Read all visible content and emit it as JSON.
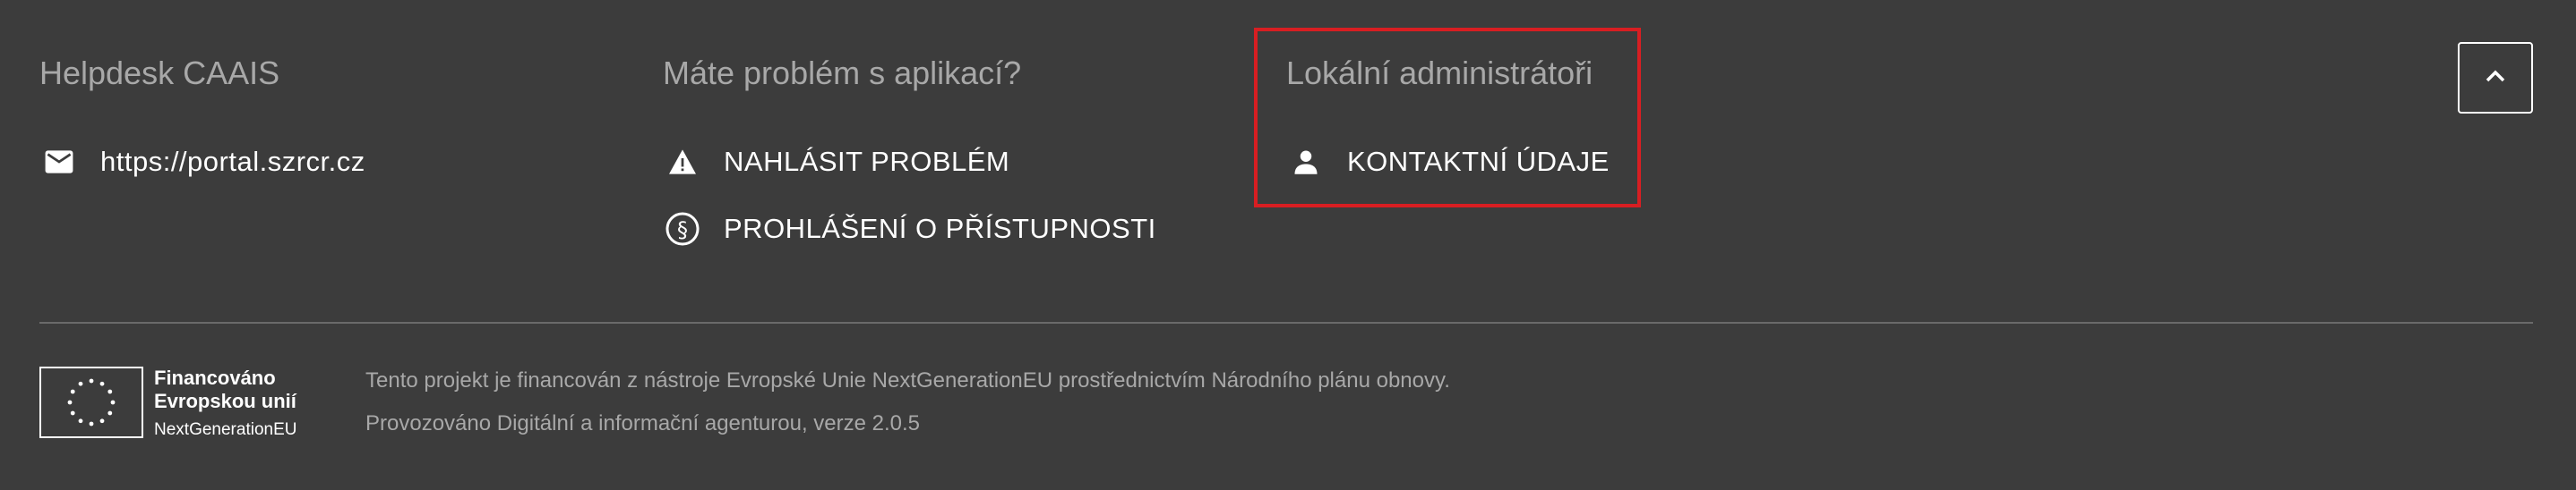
{
  "columns": [
    {
      "title": "Helpdesk CAAIS",
      "links": [
        {
          "icon": "mail-icon",
          "label": "https://portal.szrcr.cz"
        }
      ]
    },
    {
      "title": "Máte problém s aplikací?",
      "links": [
        {
          "icon": "warning-icon",
          "label": "NAHLÁSIT PROBLÉM"
        },
        {
          "icon": "paragraph-icon",
          "label": "PROHLÁŠENÍ O PŘÍSTUPNOSTI"
        }
      ]
    },
    {
      "title": "Lokální administrátoři",
      "links": [
        {
          "icon": "person-icon",
          "label": "KONTAKTNÍ ÚDAJE"
        }
      ]
    }
  ],
  "scroll_top": {
    "icon": "chevron-up-icon"
  },
  "eu_logo": {
    "line1": "Financováno",
    "line2": "Evropskou unií",
    "line3": "NextGenerationEU"
  },
  "info": {
    "funding": "Tento projekt je financován z nástroje Evropské Unie NextGenerationEU prostřednictvím Národního plánu obnovy.",
    "operator": "Provozováno Digitální a informační agenturou, verze 2.0.5"
  },
  "colors": {
    "background": "#3c3c3c",
    "highlight": "#d81e22",
    "muted_text": "#a8a8a8"
  }
}
